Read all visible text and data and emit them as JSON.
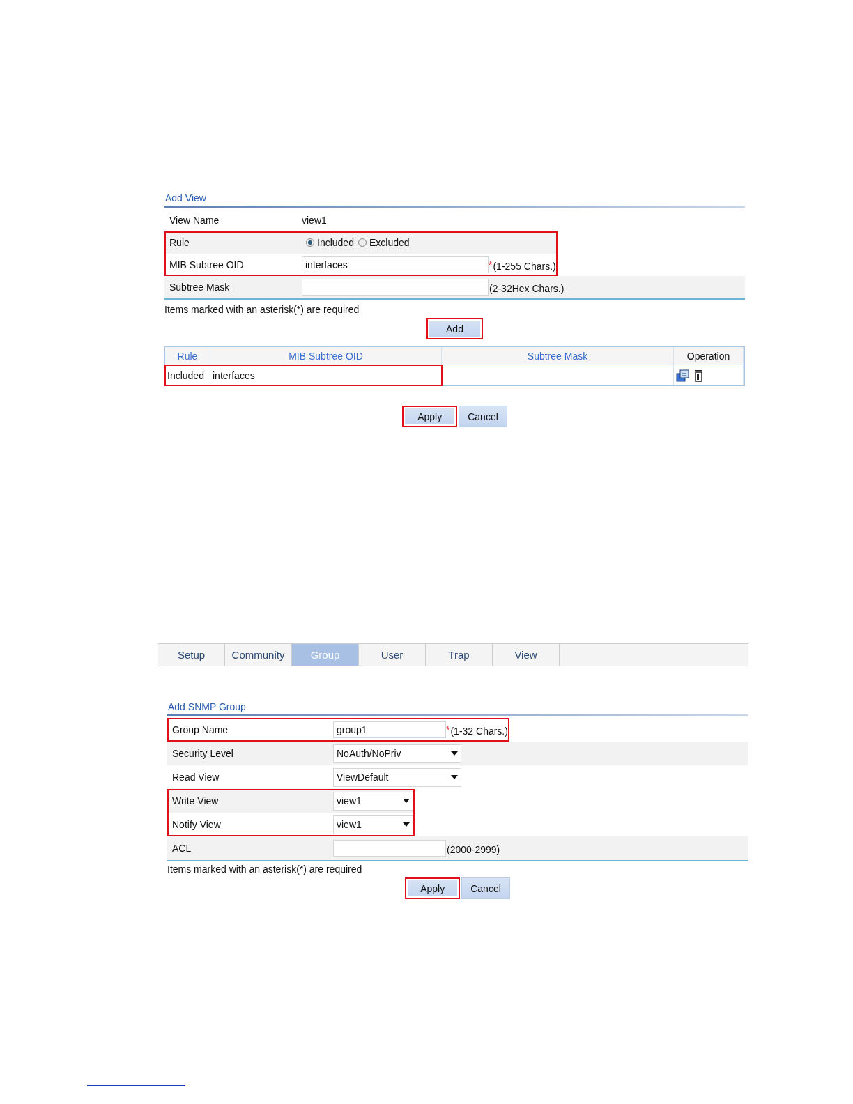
{
  "add_view": {
    "title": "Add View",
    "rows": [
      {
        "kind": "text",
        "label": "View Name",
        "value": "view1",
        "highlighted": false
      },
      {
        "kind": "radio",
        "label": "Rule",
        "options": [
          {
            "label": "Included",
            "selected": true
          },
          {
            "label": "Excluded",
            "selected": false
          }
        ],
        "highlighted": true
      },
      {
        "kind": "input",
        "label": "MIB Subtree OID",
        "value": "interfaces",
        "required_mark": "*",
        "hint": "(1-255 Chars.)",
        "highlighted": true
      },
      {
        "kind": "input",
        "label": "Subtree Mask",
        "hint": "(2-32Hex Chars.)",
        "highlighted": false
      }
    ],
    "note": "Items marked with an asterisk(*) are required",
    "add_button": {
      "label": "Add",
      "highlighted": true
    },
    "table": {
      "columns": [
        {
          "label": "Rule",
          "kind": "link"
        },
        {
          "label": "MIB Subtree OID",
          "kind": "link"
        },
        {
          "label": "Subtree Mask",
          "kind": "link"
        },
        {
          "label": "Operation",
          "kind": "plain"
        }
      ],
      "rows": [
        {
          "rule": "Included",
          "oid": "interfaces",
          "highlighted": true
        }
      ]
    },
    "buttons": [
      {
        "label": "Apply",
        "highlighted": true
      },
      {
        "label": "Cancel",
        "highlighted": false
      }
    ]
  },
  "snmp": {
    "tabs": [
      {
        "label": "Setup",
        "selected": false
      },
      {
        "label": "Community",
        "selected": false
      },
      {
        "label": "Group",
        "selected": true
      },
      {
        "label": "User",
        "selected": false
      },
      {
        "label": "Trap",
        "selected": false
      },
      {
        "label": "View",
        "selected": false
      }
    ],
    "title": "Add SNMP Group",
    "rows": [
      {
        "kind": "input",
        "label": "Group Name",
        "value": "group1",
        "required_mark": "*",
        "hint": "(1-32 Chars.)",
        "highlighted": true
      },
      {
        "kind": "select",
        "label": "Security Level",
        "value": "NoAuth/NoPriv",
        "highlighted": false
      },
      {
        "kind": "select",
        "label": "Read View",
        "value": "ViewDefault",
        "highlighted": false
      },
      {
        "kind": "select",
        "label": "Write View",
        "value": "view1",
        "highlighted": true
      },
      {
        "kind": "select",
        "label": "Notify View",
        "value": "view1",
        "highlighted": true
      },
      {
        "kind": "input",
        "label": "ACL",
        "hint": "(2000-2999)",
        "highlighted": false
      }
    ],
    "note": "Items marked with an asterisk(*) are required",
    "buttons": [
      {
        "label": "Apply",
        "highlighted": true
      },
      {
        "label": "Cancel",
        "highlighted": false
      }
    ]
  }
}
